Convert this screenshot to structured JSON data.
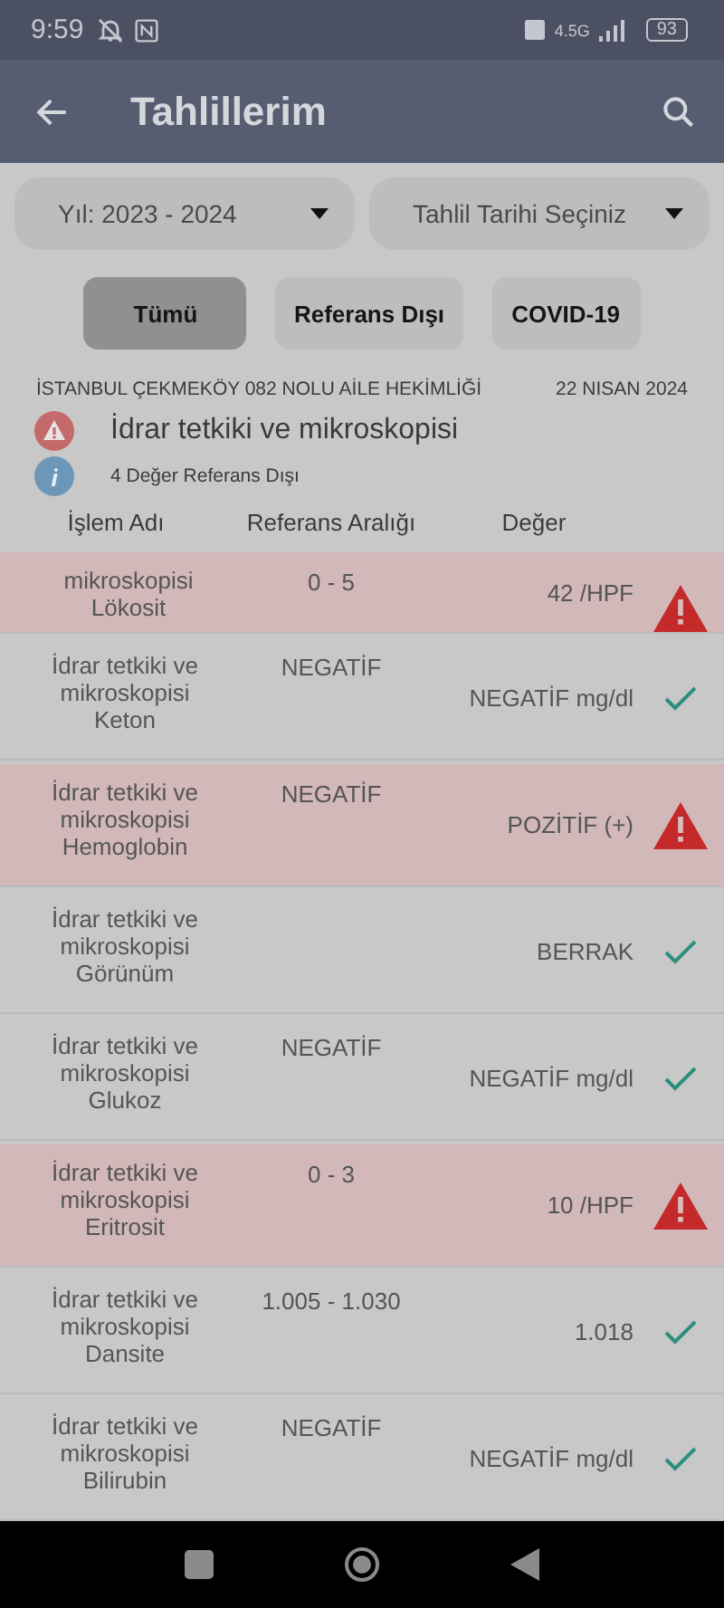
{
  "status_bar": {
    "time": "9:59",
    "battery": "93",
    "network": "4.5G"
  },
  "app_bar": {
    "title": "Tahlillerim"
  },
  "filters": [
    {
      "label": "Yıl: 2023 - 2024"
    },
    {
      "label": "Tahlil Tarihi Seçiniz"
    }
  ],
  "tabs": [
    {
      "label": "Tümü",
      "selected": true
    },
    {
      "label": "Referans Dışı",
      "selected": false
    },
    {
      "label": "COVID-19",
      "selected": false
    }
  ],
  "report": {
    "clinic": "İSTANBUL ÇEKMEKÖY 082 NOLU AİLE HEKİMLİĞİ",
    "date": "22 NISAN 2024",
    "title": "İdrar tetkiki ve mikroskopisi",
    "summary": "4 Değer Referans Dışı"
  },
  "table": {
    "columns": [
      "İşlem Adı",
      "Referans Aralığı",
      "Değer"
    ],
    "rows": [
      {
        "name": "mikroskopisi Lökosit",
        "reference": "0 - 5",
        "value": "42 /HPF",
        "out_of_range": true
      },
      {
        "name": "İdrar tetkiki ve mikroskopisi Keton",
        "reference": "NEGATİF",
        "value": "NEGATİF mg/dl",
        "out_of_range": false
      },
      {
        "name": "İdrar tetkiki ve mikroskopisi Hemoglobin",
        "reference": "NEGATİF",
        "value": "POZİTİF (+)",
        "out_of_range": true
      },
      {
        "name": "İdrar tetkiki ve mikroskopisi Görünüm",
        "value": "BERRAK",
        "out_of_range": false
      },
      {
        "name": "İdrar tetkiki ve mikroskopisi Glukoz",
        "reference": "NEGATİF",
        "value": "NEGATİF mg/dl",
        "out_of_range": false
      },
      {
        "name": "İdrar tetkiki ve mikroskopisi Eritrosit",
        "reference": "0 - 3",
        "value": "10 /HPF",
        "out_of_range": true
      },
      {
        "name": "İdrar tetkiki ve mikroskopisi Dansite",
        "reference": "1.005 - 1.030",
        "value": "1.018",
        "out_of_range": false
      },
      {
        "name": "İdrar tetkiki ve mikroskopisi Bilirubin",
        "reference": "NEGATİF",
        "value": "NEGATİF mg/dl",
        "out_of_range": false
      }
    ]
  }
}
